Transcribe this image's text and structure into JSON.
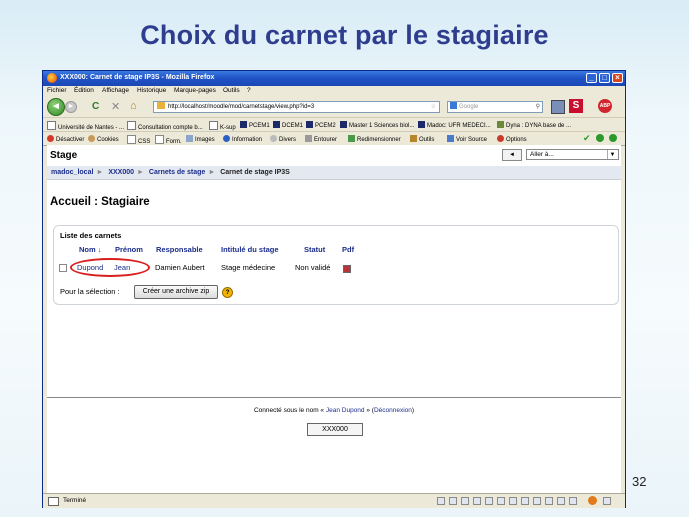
{
  "slide": {
    "title": "Choix du carnet par le stagiaire",
    "page_number": "32"
  },
  "window": {
    "title": "XXX000: Carnet de stage IP3S - Mozilla Firefox",
    "menu": [
      "Fichier",
      "Édition",
      "Affichage",
      "Historique",
      "Marque-pages",
      "Outils",
      "?"
    ],
    "url": "http://localhost/moodle/mod/carnetstage/view.php?id=3",
    "search_placeholder": "Google",
    "bookmarks": [
      "Université de Nantes - ...",
      "Consultation compte b...",
      "K-sup",
      "PCEM1",
      "DCEM1",
      "PCEM2",
      "Master 1 Sciences biol...",
      "Madoc: UFR MEDECI...",
      "Dyna : DYNA base de ..."
    ],
    "webdev": [
      "Désactiver",
      "Cookies",
      "CSS",
      "Form.",
      "Images",
      "Information",
      "Divers",
      "Entourer",
      "Redimensionner",
      "Outils",
      "Voir Source",
      "Options"
    ],
    "status": "Terminé"
  },
  "page": {
    "course_title": "Stage",
    "back_button": "◄",
    "jump_select": "Aller à...",
    "breadcrumb": [
      "madoc_local",
      "XXX000",
      "Carnets de stage",
      "Carnet de stage IP3S"
    ],
    "heading": "Accueil : Stagiaire",
    "box_title": "Liste des carnets",
    "table": {
      "headers": [
        "Nom ↓",
        "Prénom",
        "Responsable",
        "Intitulé du stage",
        "Statut",
        "Pdf"
      ],
      "rows": [
        [
          "Dupond",
          "Jean",
          "Damien Aubert",
          "Stage médecine",
          "Non validé",
          ""
        ]
      ]
    },
    "selection_label": "Pour la sélection :",
    "zip_button": "Créer une archive zip",
    "help_icon": "?",
    "footer_prefix": "Connecté sous le nom «",
    "footer_user": "Jean Dupond",
    "footer_mid": "» (",
    "footer_logout": "Déconnexion",
    "footer_suffix": ")",
    "home_button": "XXX000"
  },
  "colors": {
    "title": "#2f3d8f",
    "link": "#1a2d8a",
    "highlight_ellipse": "#d8201f",
    "titlebar": "#2154c8"
  }
}
